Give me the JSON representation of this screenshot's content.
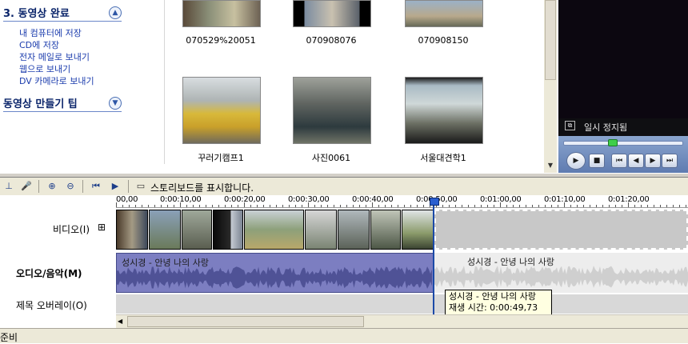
{
  "task_pane": {
    "section3_title": "3. 동영상 완료",
    "tasks": [
      "내 컴퓨터에 저장",
      "CD에 저장",
      "전자 메일로 보내기",
      "웹으로 보내기",
      "DV 카메라로 보내기"
    ],
    "tips_title": "동영상 만들기 팁"
  },
  "collection": {
    "row1": [
      "070529%20051",
      "070908076",
      "070908150"
    ],
    "row2": [
      "꾸러기캠프1",
      "사진0061",
      "서울대견학1"
    ]
  },
  "monitor": {
    "status": "일시 정지됨"
  },
  "timeline_toolbar": {
    "storyboard_label": "스토리보드를 표시합니다."
  },
  "ruler": {
    "labels": [
      "00,00",
      "0:00:10,00",
      "0:00:20,00",
      "0:00:30,00",
      "0:00:40,00",
      "0:00:50,00",
      "0:01:00,00",
      "0:01:10,00",
      "0:01:20,00"
    ]
  },
  "tracks": {
    "video": "비디오(I)",
    "video_expand": "⊞",
    "audio": "오디오/음악(M)",
    "overlay": "제목 오버레이(O)"
  },
  "audio_clip": {
    "name": "성시경 - 안녕 나의 사랑",
    "ghost_name": "성시경 - 안녕 나의 사랑"
  },
  "tooltip": {
    "line1": "성시경 - 안녕 나의 사랑",
    "line2": "재생 시간:  0:00:49,73"
  },
  "status": {
    "text": "준비"
  },
  "colors": {
    "audio_clip": "#7c7ec1",
    "playhead": "#1c4aa8",
    "link": "#1b3cad"
  }
}
